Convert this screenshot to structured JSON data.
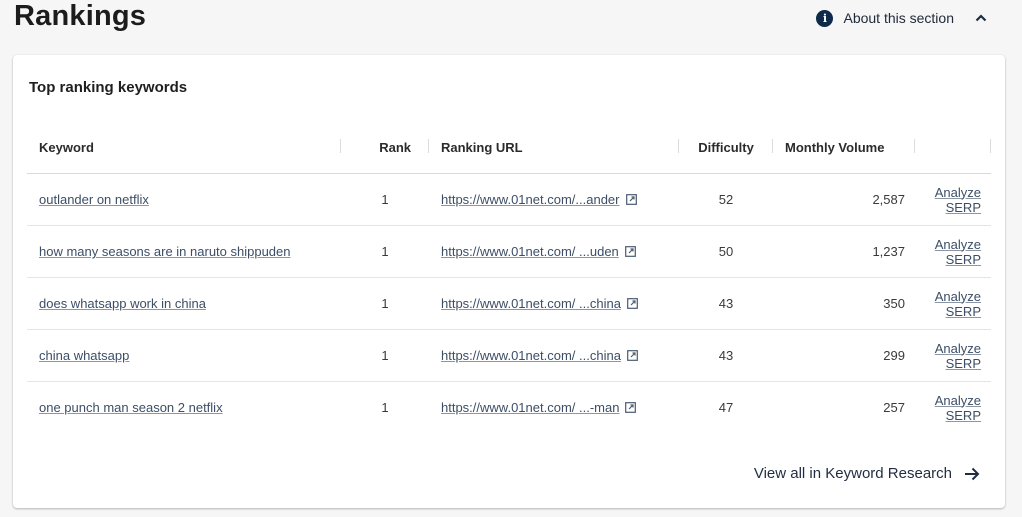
{
  "header": {
    "title": "Rankings",
    "about_label": "About this section"
  },
  "card": {
    "title": "Top ranking keywords",
    "columns": {
      "keyword": "Keyword",
      "rank": "Rank",
      "ranking_url": "Ranking URL",
      "difficulty": "Difficulty",
      "monthly_volume": "Monthly Volume"
    },
    "rows": [
      {
        "keyword": "outlander on netflix",
        "rank": "1",
        "url_base": "https://www.01net.com/",
        "url_tail": "...ander",
        "difficulty": "52",
        "volume": "2,587",
        "action": "Analyze SERP"
      },
      {
        "keyword": "how many seasons are in naruto shippuden",
        "rank": "1",
        "url_base": "https://www.01net.com/",
        "url_tail": " ...uden",
        "difficulty": "50",
        "volume": "1,237",
        "action": "Analyze SERP"
      },
      {
        "keyword": "does whatsapp work in china",
        "rank": "1",
        "url_base": "https://www.01net.com/",
        "url_tail": " ...china",
        "difficulty": "43",
        "volume": "350",
        "action": "Analyze SERP"
      },
      {
        "keyword": "china whatsapp",
        "rank": "1",
        "url_base": "https://www.01net.com/",
        "url_tail": " ...china",
        "difficulty": "43",
        "volume": "299",
        "action": "Analyze SERP"
      },
      {
        "keyword": "one punch man season 2 netflix",
        "rank": "1",
        "url_base": "https://www.01net.com/",
        "url_tail": " ...-man",
        "difficulty": "47",
        "volume": "257",
        "action": "Analyze SERP"
      }
    ],
    "footer_link": "View all in Keyword Research"
  },
  "icons": {
    "info": "info-icon",
    "collapse": "chevron-up-icon",
    "external": "external-link-icon",
    "arrow": "arrow-right-icon"
  }
}
